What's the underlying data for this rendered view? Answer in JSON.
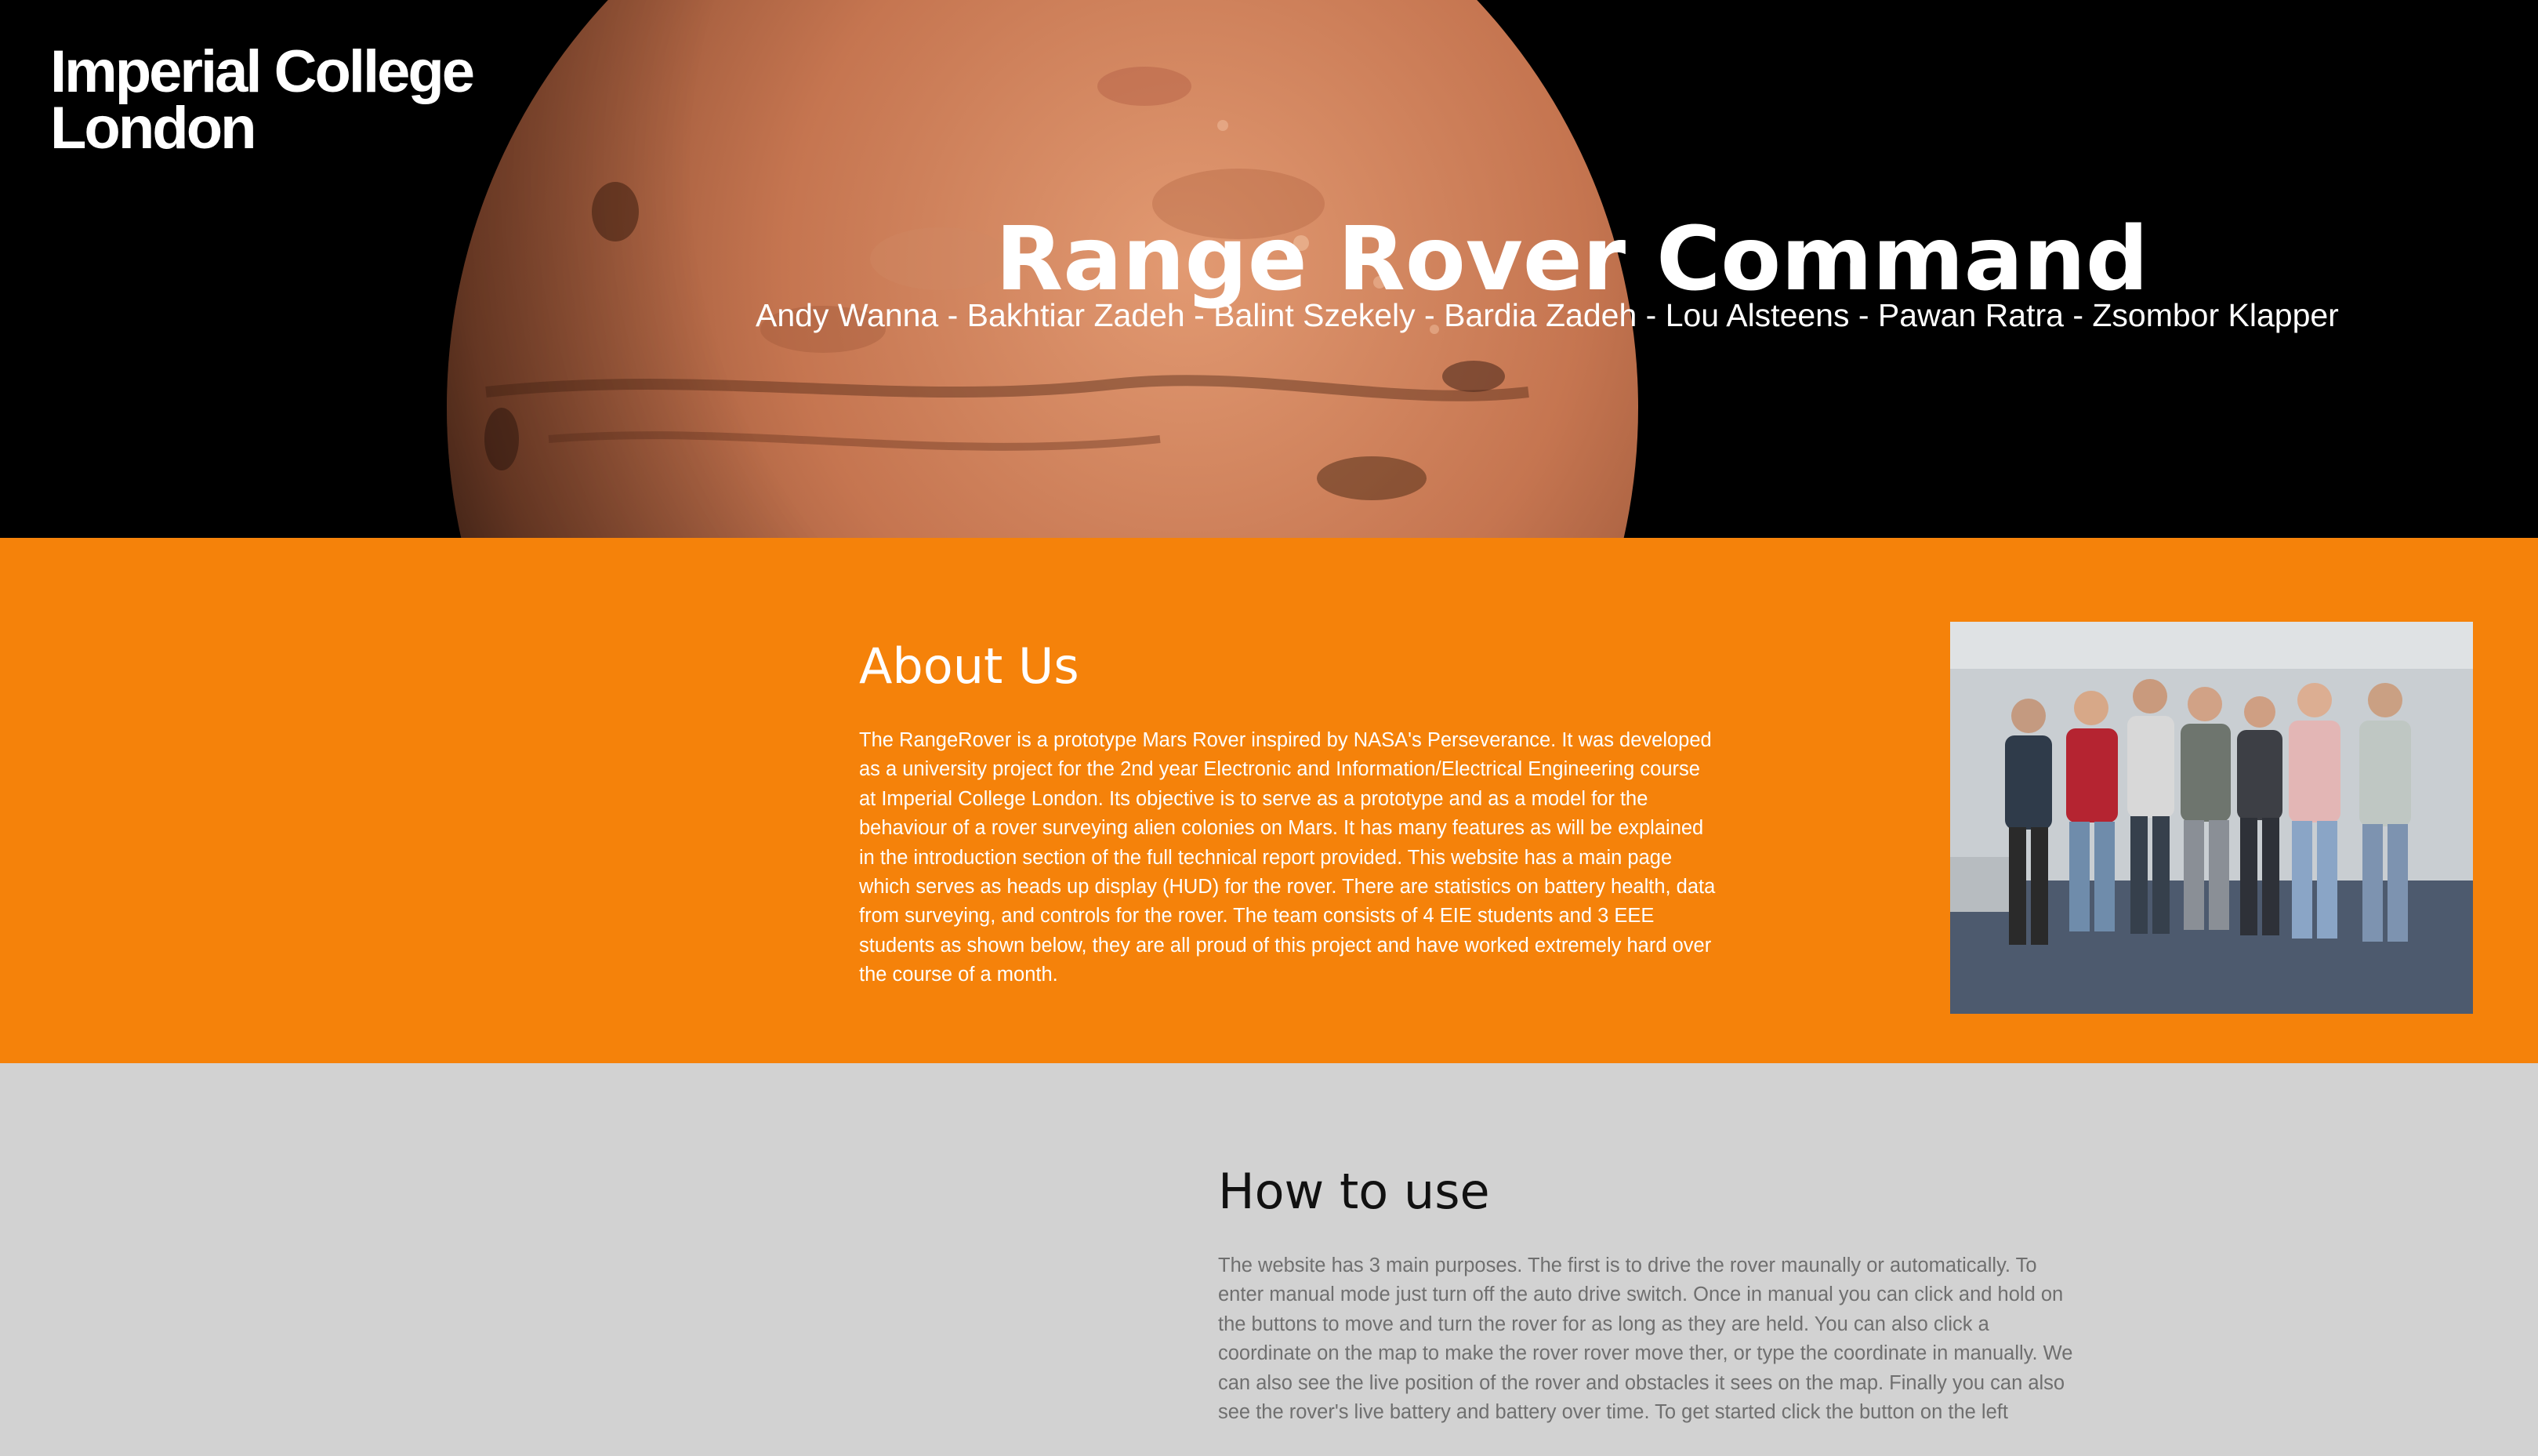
{
  "brand": {
    "logo_line1": "Imperial College",
    "logo_line2": "London"
  },
  "hero": {
    "title": "Range Rover Command",
    "team": "Andy Wanna - Bakhtiar Zadeh - Balint Szekely - Bardia Zadeh - Lou Alsteens - Pawan Ratra - Zsombor Klapper",
    "background_color": "#000000",
    "image": "mars-planet-image"
  },
  "about": {
    "heading": "About Us",
    "body": "The RangeRover is a prototype Mars Rover inspired by NASA's Perseverance. It was developed as a university project for the 2nd year Electronic and Information/Electrical Engineering course at Imperial College London. Its objective is to serve as a prototype and as a model for the behaviour of a rover surveying alien colonies on Mars. It has many features as will be explained in the introduction section of the full technical report provided. This website has a main page which serves as heads up display (HUD) for the rover. There are statistics on battery health, data from surveying, and controls for the rover. The team consists of 4 EIE students and 3 EEE students as shown below, they are all proud of this project and have worked extremely hard over the course of a month.",
    "background_color": "#f5820a",
    "photo": "team-photo"
  },
  "howto": {
    "heading": "How to use",
    "body": "The website has 3 main purposes. The first is to drive the rover maunally or automatically. To enter manual mode just turn off the auto drive switch. Once in manual you can click and hold on the buttons to move and turn the rover for as long as they are held. You can also click a coordinate on the map to make the rover rover move ther, or type the coordinate in manually. We can also see the live position of the rover and obstacles it sees on the map. Finally you can also see the rover's live battery and battery over time. To get started click the button on the left",
    "background_color": "#d2d2d2"
  }
}
